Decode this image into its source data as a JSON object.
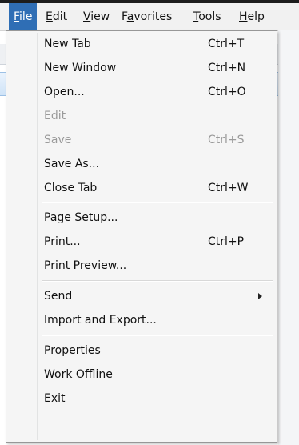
{
  "menubar": {
    "items": [
      {
        "pre": "",
        "mn": "F",
        "post": "ile"
      },
      {
        "pre": "",
        "mn": "E",
        "post": "dit"
      },
      {
        "pre": "",
        "mn": "V",
        "post": "iew"
      },
      {
        "pre": "F",
        "mn": "a",
        "post": "vorites"
      },
      {
        "pre": "",
        "mn": "T",
        "post": "ools"
      },
      {
        "pre": "",
        "mn": "H",
        "post": "elp"
      }
    ]
  },
  "file_menu": {
    "items": [
      {
        "label": "New Tab",
        "shortcut": "Ctrl+T"
      },
      {
        "label": "New Window",
        "shortcut": "Ctrl+N"
      },
      {
        "label": "Open...",
        "shortcut": "Ctrl+O"
      },
      {
        "label": "Edit",
        "shortcut": ""
      },
      {
        "label": "Save",
        "shortcut": "Ctrl+S"
      },
      {
        "label": "Save As...",
        "shortcut": ""
      },
      {
        "label": "Close Tab",
        "shortcut": "Ctrl+W"
      },
      {
        "label": "Page Setup...",
        "shortcut": ""
      },
      {
        "label": "Print...",
        "shortcut": "Ctrl+P"
      },
      {
        "label": "Print Preview...",
        "shortcut": ""
      },
      {
        "label": "Send",
        "shortcut": ""
      },
      {
        "label": "Import and Export...",
        "shortcut": ""
      },
      {
        "label": "Properties",
        "shortcut": ""
      },
      {
        "label": "Work Offline",
        "shortcut": ""
      },
      {
        "label": "Exit",
        "shortcut": ""
      }
    ]
  },
  "colors": {
    "active_menu_bg": "#2f6eb5",
    "menu_bg": "#f5f5f5",
    "disabled_text": "#9a9a9a"
  }
}
